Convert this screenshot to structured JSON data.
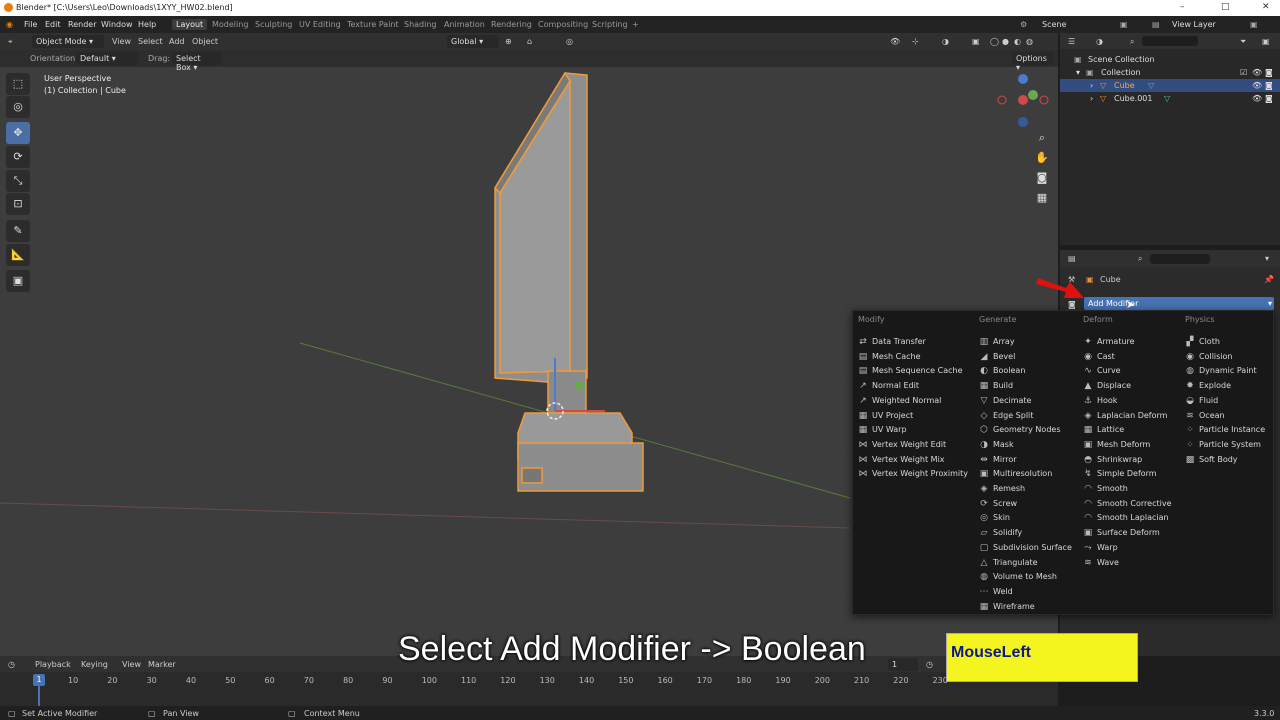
{
  "window": {
    "title": "Blender* [C:\\Users\\Leo\\Downloads\\1XYY_HW02.blend]",
    "min": "–",
    "max": "□",
    "close": "✕"
  },
  "menubar": {
    "menus": [
      "File",
      "Edit",
      "Render",
      "Window",
      "Help"
    ],
    "workspaces": [
      "Layout",
      "Modeling",
      "Sculpting",
      "UV Editing",
      "Texture Paint",
      "Shading",
      "Animation",
      "Rendering",
      "Compositing",
      "Scripting"
    ],
    "add_tab": "+",
    "scene": "Scene",
    "view_layer": "View Layer"
  },
  "viewport": {
    "mode": "Object Mode",
    "menus": [
      "View",
      "Select",
      "Add",
      "Object"
    ],
    "transform_orientation": "Global",
    "orientation_label": "Orientation:",
    "orientation_value": "Default",
    "drag_label": "Drag:",
    "drag_value": "Select Box",
    "options": "Options",
    "overlay_line1": "User Perspective",
    "overlay_line2": "(1) Collection | Cube",
    "axis_x": "X",
    "axis_y": "Y",
    "axis_z": "Z"
  },
  "outliner": {
    "scene_collection": "Scene Collection",
    "collection": "Collection",
    "items": [
      "Cube",
      "Cube.001"
    ]
  },
  "properties": {
    "object_name": "Cube",
    "add_modifier": "Add Modifier"
  },
  "modifier_menu": {
    "columns": [
      {
        "header": "Modify",
        "items": [
          {
            "icon": "⇄",
            "label": "Data Transfer"
          },
          {
            "icon": "▤",
            "label": "Mesh Cache"
          },
          {
            "icon": "▤",
            "label": "Mesh Sequence Cache"
          },
          {
            "icon": "↗",
            "label": "Normal Edit"
          },
          {
            "icon": "↗",
            "label": "Weighted Normal"
          },
          {
            "icon": "▦",
            "label": "UV Project"
          },
          {
            "icon": "▦",
            "label": "UV Warp"
          },
          {
            "icon": "⋈",
            "label": "Vertex Weight Edit"
          },
          {
            "icon": "⋈",
            "label": "Vertex Weight Mix"
          },
          {
            "icon": "⋈",
            "label": "Vertex Weight Proximity"
          }
        ]
      },
      {
        "header": "Generate",
        "items": [
          {
            "icon": "▥",
            "label": "Array"
          },
          {
            "icon": "◢",
            "label": "Bevel"
          },
          {
            "icon": "◐",
            "label": "Boolean"
          },
          {
            "icon": "▦",
            "label": "Build"
          },
          {
            "icon": "▽",
            "label": "Decimate"
          },
          {
            "icon": "◇",
            "label": "Edge Split"
          },
          {
            "icon": "⬡",
            "label": "Geometry Nodes"
          },
          {
            "icon": "◑",
            "label": "Mask"
          },
          {
            "icon": "⇹",
            "label": "Mirror"
          },
          {
            "icon": "▣",
            "label": "Multiresolution"
          },
          {
            "icon": "◈",
            "label": "Remesh"
          },
          {
            "icon": "⟳",
            "label": "Screw"
          },
          {
            "icon": "◎",
            "label": "Skin"
          },
          {
            "icon": "▱",
            "label": "Solidify"
          },
          {
            "icon": "▢",
            "label": "Subdivision Surface"
          },
          {
            "icon": "△",
            "label": "Triangulate"
          },
          {
            "icon": "◍",
            "label": "Volume to Mesh"
          },
          {
            "icon": "⋯",
            "label": "Weld"
          },
          {
            "icon": "▦",
            "label": "Wireframe"
          }
        ]
      },
      {
        "header": "Deform",
        "items": [
          {
            "icon": "✦",
            "label": "Armature"
          },
          {
            "icon": "◉",
            "label": "Cast"
          },
          {
            "icon": "∿",
            "label": "Curve"
          },
          {
            "icon": "▲",
            "label": "Displace"
          },
          {
            "icon": "⚓",
            "label": "Hook"
          },
          {
            "icon": "◈",
            "label": "Laplacian Deform"
          },
          {
            "icon": "▦",
            "label": "Lattice"
          },
          {
            "icon": "▣",
            "label": "Mesh Deform"
          },
          {
            "icon": "◓",
            "label": "Shrinkwrap"
          },
          {
            "icon": "↯",
            "label": "Simple Deform"
          },
          {
            "icon": "◠",
            "label": "Smooth"
          },
          {
            "icon": "◠",
            "label": "Smooth Corrective"
          },
          {
            "icon": "◠",
            "label": "Smooth Laplacian"
          },
          {
            "icon": "▣",
            "label": "Surface Deform"
          },
          {
            "icon": "⤳",
            "label": "Warp"
          },
          {
            "icon": "≋",
            "label": "Wave"
          }
        ]
      },
      {
        "header": "Physics",
        "items": [
          {
            "icon": "▞",
            "label": "Cloth"
          },
          {
            "icon": "◉",
            "label": "Collision"
          },
          {
            "icon": "◍",
            "label": "Dynamic Paint"
          },
          {
            "icon": "✸",
            "label": "Explode"
          },
          {
            "icon": "◒",
            "label": "Fluid"
          },
          {
            "icon": "≋",
            "label": "Ocean"
          },
          {
            "icon": "⁘",
            "label": "Particle Instance"
          },
          {
            "icon": "⁘",
            "label": "Particle System"
          },
          {
            "icon": "▩",
            "label": "Soft Body"
          }
        ]
      }
    ]
  },
  "timeline": {
    "menus": [
      "Playback",
      "Keying",
      "View",
      "Marker"
    ],
    "current_frame": "1",
    "frame_field": "1",
    "ticks": [
      "10",
      "20",
      "30",
      "40",
      "50",
      "60",
      "70",
      "80",
      "90",
      "100",
      "110",
      "120",
      "130",
      "140",
      "150",
      "160",
      "170",
      "180",
      "190",
      "200",
      "210",
      "220",
      "230"
    ]
  },
  "status": {
    "left": "Set Active Modifier",
    "middle": "Pan View",
    "right": "Context Menu",
    "version": "3.3.0"
  },
  "caption": "Select Add Modifier -> Boolean",
  "mouse_overlay": "MouseLeft",
  "colors": {
    "accent": "#4772b3",
    "selection_orange": "#e8923a",
    "menu_bg": "#181818",
    "caption_box": "#f4f41e"
  }
}
